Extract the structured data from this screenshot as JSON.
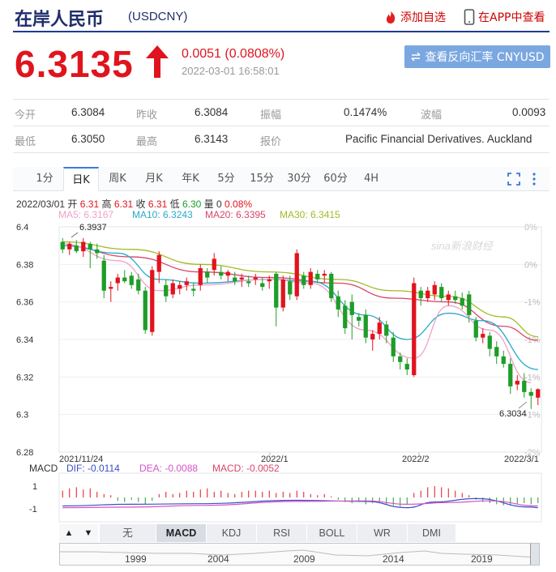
{
  "header": {
    "title": "在岸人民币",
    "code": "(USDCNY)",
    "add_watch": "添加自选",
    "open_app": "在APP中查看"
  },
  "quote": {
    "price": "6.3135",
    "change": "0.0051 (0.0808%)",
    "time": "2022-03-01 16:58:01",
    "reverse_button": "查看反向汇率 CNYUSD"
  },
  "stats": {
    "row1": [
      {
        "label": "今开",
        "value": "6.3084"
      },
      {
        "label": "昨收",
        "value": "6.3084"
      },
      {
        "label": "振幅",
        "value": "0.1474%"
      },
      {
        "label": "波幅",
        "value": "0.0093"
      }
    ],
    "row2": [
      {
        "label": "最低",
        "value": "6.3050"
      },
      {
        "label": "最高",
        "value": "6.3143"
      },
      {
        "label": "报价",
        "value": "Pacific Financial Derivatives. Auckland"
      }
    ]
  },
  "tabs": [
    "1分",
    "日K",
    "周K",
    "月K",
    "年K",
    "5分",
    "15分",
    "30分",
    "60分",
    "4H"
  ],
  "active_tab": "日K",
  "kline_info": {
    "date": "2022/03/01",
    "open_label": "开",
    "open": "6.31",
    "high_label": "高",
    "high": "6.31",
    "close_label": "收",
    "close": "6.31",
    "low_label": "低",
    "low": "6.30",
    "vol_label": "量",
    "vol": "0",
    "pct": "0.08%"
  },
  "ma": {
    "ma5": "MA5: 6.3167",
    "ma10": "MA10: 6.3243",
    "ma20": "MA20: 6.3395",
    "ma30": "MA30: 6.3415"
  },
  "colors": {
    "up": "#e0141e",
    "down": "#1e9d28",
    "ma5": "#f2a0c8",
    "ma10": "#27a9c9",
    "ma20": "#d8456a",
    "ma30": "#a5b828",
    "dif": "#3d4fc4",
    "dea": "#d653c8",
    "accent": "#3c78d8"
  },
  "watermark": "sina新浪财经",
  "macd": {
    "label": "MACD",
    "dif": "DIF: -0.0114",
    "dea": "DEA: -0.0088",
    "macd": "MACD: -0.0052",
    "y_ticks": [
      "1",
      "-1"
    ]
  },
  "indicators": [
    "无",
    "MACD",
    "KDJ",
    "RSI",
    "BOLL",
    "WR",
    "DMI"
  ],
  "active_indicator": "MACD",
  "nav": {
    "up": "▲",
    "down": "▼"
  },
  "timeline_years": [
    "1999",
    "2004",
    "2009",
    "2014",
    "2019"
  ],
  "chart_data": {
    "type": "candlestick",
    "y_ticks": [
      "6.4",
      "6.38",
      "6.36",
      "6.34",
      "6.32",
      "6.3",
      "6.28"
    ],
    "pct_ticks": [
      "0%",
      "0%",
      "-1%",
      "-1%",
      "-1%",
      "-1%",
      "-2%"
    ],
    "ylim": [
      6.28,
      6.4
    ],
    "x_labels": [
      "2021/11/24",
      "2022/1",
      "2022/2",
      "2022/3/1"
    ],
    "annotations": {
      "max": "6.3937",
      "min": "6.3034"
    },
    "candles": [
      {
        "o": 6.392,
        "h": 6.394,
        "l": 6.386,
        "c": 6.388
      },
      {
        "o": 6.388,
        "h": 6.392,
        "l": 6.385,
        "c": 6.391
      },
      {
        "o": 6.39,
        "h": 6.393,
        "l": 6.386,
        "c": 6.387
      },
      {
        "o": 6.387,
        "h": 6.394,
        "l": 6.384,
        "c": 6.392
      },
      {
        "o": 6.391,
        "h": 6.392,
        "l": 6.378,
        "c": 6.388
      },
      {
        "o": 6.388,
        "h": 6.391,
        "l": 6.383,
        "c": 6.386
      },
      {
        "o": 6.382,
        "h": 6.385,
        "l": 6.362,
        "c": 6.366
      },
      {
        "o": 6.367,
        "h": 6.371,
        "l": 6.36,
        "c": 6.368
      },
      {
        "o": 6.37,
        "h": 6.375,
        "l": 6.366,
        "c": 6.373
      },
      {
        "o": 6.373,
        "h": 6.377,
        "l": 6.37,
        "c": 6.371
      },
      {
        "o": 6.374,
        "h": 6.376,
        "l": 6.367,
        "c": 6.369
      },
      {
        "o": 6.372,
        "h": 6.375,
        "l": 6.364,
        "c": 6.366
      },
      {
        "o": 6.366,
        "h": 6.368,
        "l": 6.343,
        "c": 6.345
      },
      {
        "o": 6.344,
        "h": 6.379,
        "l": 6.342,
        "c": 6.377
      },
      {
        "o": 6.376,
        "h": 6.387,
        "l": 6.37,
        "c": 6.385
      },
      {
        "o": 6.369,
        "h": 6.372,
        "l": 6.36,
        "c": 6.363
      },
      {
        "o": 6.364,
        "h": 6.372,
        "l": 6.362,
        "c": 6.37
      },
      {
        "o": 6.367,
        "h": 6.371,
        "l": 6.364,
        "c": 6.369
      },
      {
        "o": 6.369,
        "h": 6.373,
        "l": 6.366,
        "c": 6.371
      },
      {
        "o": 6.367,
        "h": 6.37,
        "l": 6.363,
        "c": 6.366
      },
      {
        "o": 6.369,
        "h": 6.38,
        "l": 6.366,
        "c": 6.378
      },
      {
        "o": 6.376,
        "h": 6.378,
        "l": 6.37,
        "c": 6.373
      },
      {
        "o": 6.377,
        "h": 6.386,
        "l": 6.374,
        "c": 6.383
      },
      {
        "o": 6.376,
        "h": 6.379,
        "l": 6.372,
        "c": 6.374
      },
      {
        "o": 6.374,
        "h": 6.377,
        "l": 6.371,
        "c": 6.376
      },
      {
        "o": 6.373,
        "h": 6.376,
        "l": 6.369,
        "c": 6.371
      },
      {
        "o": 6.372,
        "h": 6.375,
        "l": 6.368,
        "c": 6.373
      },
      {
        "o": 6.371,
        "h": 6.374,
        "l": 6.368,
        "c": 6.37
      },
      {
        "o": 6.372,
        "h": 6.375,
        "l": 6.369,
        "c": 6.373
      },
      {
        "o": 6.37,
        "h": 6.373,
        "l": 6.366,
        "c": 6.368
      },
      {
        "o": 6.371,
        "h": 6.374,
        "l": 6.367,
        "c": 6.372
      },
      {
        "o": 6.375,
        "h": 6.376,
        "l": 6.347,
        "c": 6.357
      },
      {
        "o": 6.357,
        "h": 6.374,
        "l": 6.355,
        "c": 6.372
      },
      {
        "o": 6.371,
        "h": 6.374,
        "l": 6.361,
        "c": 6.364
      },
      {
        "o": 6.363,
        "h": 6.388,
        "l": 6.361,
        "c": 6.386
      },
      {
        "o": 6.374,
        "h": 6.376,
        "l": 6.367,
        "c": 6.369
      },
      {
        "o": 6.369,
        "h": 6.378,
        "l": 6.367,
        "c": 6.376
      },
      {
        "o": 6.375,
        "h": 6.377,
        "l": 6.37,
        "c": 6.372
      },
      {
        "o": 6.374,
        "h": 6.377,
        "l": 6.37,
        "c": 6.375
      },
      {
        "o": 6.375,
        "h": 6.376,
        "l": 6.36,
        "c": 6.362
      },
      {
        "o": 6.363,
        "h": 6.366,
        "l": 6.352,
        "c": 6.356
      },
      {
        "o": 6.358,
        "h": 6.361,
        "l": 6.343,
        "c": 6.346
      },
      {
        "o": 6.36,
        "h": 6.364,
        "l": 6.34,
        "c": 6.353
      },
      {
        "o": 6.352,
        "h": 6.354,
        "l": 6.347,
        "c": 6.35
      },
      {
        "o": 6.353,
        "h": 6.356,
        "l": 6.338,
        "c": 6.341
      },
      {
        "o": 6.34,
        "h": 6.345,
        "l": 6.334,
        "c": 6.343
      },
      {
        "o": 6.343,
        "h": 6.352,
        "l": 6.34,
        "c": 6.349
      },
      {
        "o": 6.348,
        "h": 6.35,
        "l": 6.338,
        "c": 6.342
      },
      {
        "o": 6.341,
        "h": 6.344,
        "l": 6.328,
        "c": 6.331
      },
      {
        "o": 6.331,
        "h": 6.333,
        "l": 6.324,
        "c": 6.328
      },
      {
        "o": 6.327,
        "h": 6.33,
        "l": 6.321,
        "c": 6.324
      },
      {
        "o": 6.321,
        "h": 6.373,
        "l": 6.32,
        "c": 6.37
      },
      {
        "o": 6.366,
        "h": 6.368,
        "l": 6.358,
        "c": 6.362
      },
      {
        "o": 6.362,
        "h": 6.368,
        "l": 6.36,
        "c": 6.366
      },
      {
        "o": 6.364,
        "h": 6.371,
        "l": 6.361,
        "c": 6.369
      },
      {
        "o": 6.368,
        "h": 6.37,
        "l": 6.36,
        "c": 6.362
      },
      {
        "o": 6.361,
        "h": 6.366,
        "l": 6.358,
        "c": 6.364
      },
      {
        "o": 6.363,
        "h": 6.366,
        "l": 6.359,
        "c": 6.361
      },
      {
        "o": 6.362,
        "h": 6.365,
        "l": 6.356,
        "c": 6.358
      },
      {
        "o": 6.364,
        "h": 6.366,
        "l": 6.349,
        "c": 6.353
      },
      {
        "o": 6.35,
        "h": 6.352,
        "l": 6.339,
        "c": 6.341
      },
      {
        "o": 6.341,
        "h": 6.346,
        "l": 6.338,
        "c": 6.343
      },
      {
        "o": 6.342,
        "h": 6.344,
        "l": 6.331,
        "c": 6.335
      },
      {
        "o": 6.336,
        "h": 6.339,
        "l": 6.327,
        "c": 6.331
      },
      {
        "o": 6.331,
        "h": 6.334,
        "l": 6.325,
        "c": 6.327
      },
      {
        "o": 6.327,
        "h": 6.33,
        "l": 6.311,
        "c": 6.315
      },
      {
        "o": 6.316,
        "h": 6.321,
        "l": 6.313,
        "c": 6.318
      },
      {
        "o": 6.318,
        "h": 6.322,
        "l": 6.309,
        "c": 6.312
      },
      {
        "o": 6.312,
        "h": 6.314,
        "l": 6.303,
        "c": 6.31
      },
      {
        "o": 6.309,
        "h": 6.314,
        "l": 6.305,
        "c": 6.3135
      }
    ],
    "ma": {
      "ma5": [
        [
          0,
          6.391
        ],
        [
          8,
          6.382
        ],
        [
          14,
          6.366
        ],
        [
          20,
          6.369
        ],
        [
          30,
          6.372
        ],
        [
          36,
          6.37
        ],
        [
          44,
          6.345
        ],
        [
          51,
          6.33
        ],
        [
          56,
          6.358
        ],
        [
          62,
          6.345
        ],
        [
          68,
          6.317
        ]
      ],
      "ma10": [
        [
          0,
          6.39
        ],
        [
          8,
          6.386
        ],
        [
          14,
          6.372
        ],
        [
          20,
          6.37
        ],
        [
          30,
          6.372
        ],
        [
          36,
          6.371
        ],
        [
          44,
          6.353
        ],
        [
          50,
          6.34
        ],
        [
          56,
          6.354
        ],
        [
          61,
          6.35
        ],
        [
          69,
          6.324
        ]
      ],
      "ma20": [
        [
          0,
          6.39
        ],
        [
          10,
          6.384
        ],
        [
          20,
          6.376
        ],
        [
          30,
          6.373
        ],
        [
          40,
          6.37
        ],
        [
          48,
          6.362
        ],
        [
          56,
          6.36
        ],
        [
          64,
          6.347
        ],
        [
          69,
          6.3395
        ]
      ],
      "ma30": [
        [
          0,
          6.392
        ],
        [
          10,
          6.388
        ],
        [
          20,
          6.38
        ],
        [
          30,
          6.376
        ],
        [
          40,
          6.372
        ],
        [
          48,
          6.366
        ],
        [
          56,
          6.363
        ],
        [
          64,
          6.352
        ],
        [
          69,
          6.3415
        ]
      ]
    },
    "macd_hist": [
      0.6,
      0.8,
      0.9,
      0.7,
      0.8,
      0.5,
      0.3,
      0.2,
      -0.3,
      -0.4,
      -0.2,
      -0.4,
      -0.6,
      -0.3,
      0.3,
      0.5,
      0.3,
      0.4,
      0.6,
      0.5,
      0.7,
      0.8,
      0.5,
      0.6,
      0.4,
      0.3,
      0.5,
      0.6,
      0.6,
      0.5,
      0.6,
      0.4,
      0.5,
      0.4,
      0.6,
      0.5,
      0.3,
      0.2,
      0.3,
      0.1,
      -0.2,
      -0.4,
      -0.5,
      -0.4,
      -0.6,
      -0.5,
      -0.4,
      -0.6,
      -0.7,
      -0.8,
      -0.6,
      0.4,
      0.6,
      0.9,
      1.0,
      0.9,
      0.8,
      0.6,
      0.4,
      0.2,
      -0.2,
      -0.4,
      -0.5,
      -0.6,
      -0.7,
      -0.7,
      -0.6,
      -0.5,
      -0.6,
      -0.5
    ],
    "dif": [
      [
        0,
        -0.75
      ],
      [
        10,
        -0.6
      ],
      [
        20,
        -0.55
      ],
      [
        34,
        -0.25
      ],
      [
        44,
        -0.35
      ],
      [
        50,
        -0.9
      ],
      [
        54,
        -0.4
      ],
      [
        60,
        -0.1
      ],
      [
        68,
        -0.85
      ],
      [
        69,
        -0.9
      ]
    ],
    "dea": [
      [
        0,
        -0.9
      ],
      [
        10,
        -0.85
      ],
      [
        20,
        -0.7
      ],
      [
        34,
        -0.35
      ],
      [
        44,
        -0.3
      ],
      [
        50,
        -0.6
      ],
      [
        56,
        -0.45
      ],
      [
        62,
        -0.3
      ],
      [
        69,
        -0.75
      ]
    ]
  }
}
